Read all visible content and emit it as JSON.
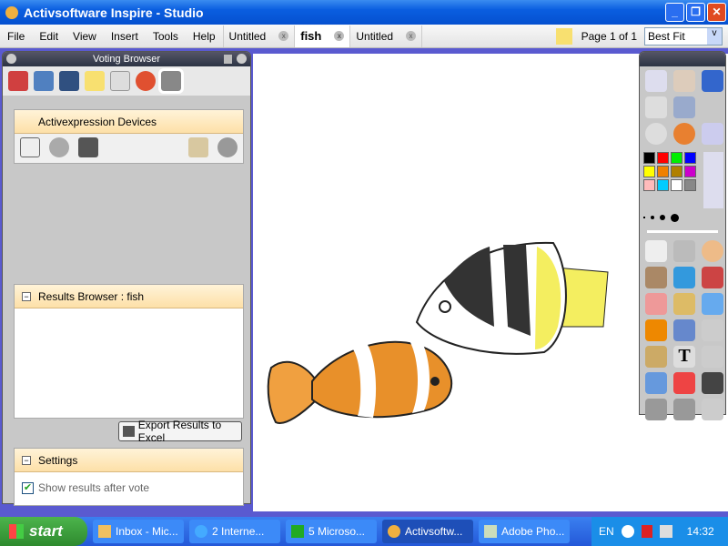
{
  "window": {
    "title": "Activsoftware Inspire - Studio"
  },
  "menu": [
    "File",
    "Edit",
    "View",
    "Insert",
    "Tools",
    "Help"
  ],
  "tabs": [
    {
      "label": "Untitled"
    },
    {
      "label": "fish",
      "active": true
    },
    {
      "label": "Untitled"
    }
  ],
  "page": {
    "indicator": "Page 1 of 1",
    "zoom": "Best Fit"
  },
  "voting": {
    "title": "Voting Browser",
    "devices": "Activexpression Devices",
    "results": "Results Browser : fish",
    "export": "Export Results to Excel",
    "settings": "Settings",
    "show_results": "Show results after vote",
    "show_results_checked": true
  },
  "palette": [
    "#000000",
    "#ff0000",
    "#00e000",
    "#0000ff",
    "#ffff00",
    "#f08000",
    "#b08000",
    "#c000c0",
    "#ffb0b0",
    "#00c0f0",
    "#ffffff",
    "#808080"
  ],
  "taskbar": {
    "start": "start",
    "items": [
      "Inbox - Mic...",
      "2 Interne...",
      "5 Microso...",
      "Activsoftw...",
      "Adobe Pho..."
    ],
    "lang": "EN",
    "clock": "14:32"
  }
}
